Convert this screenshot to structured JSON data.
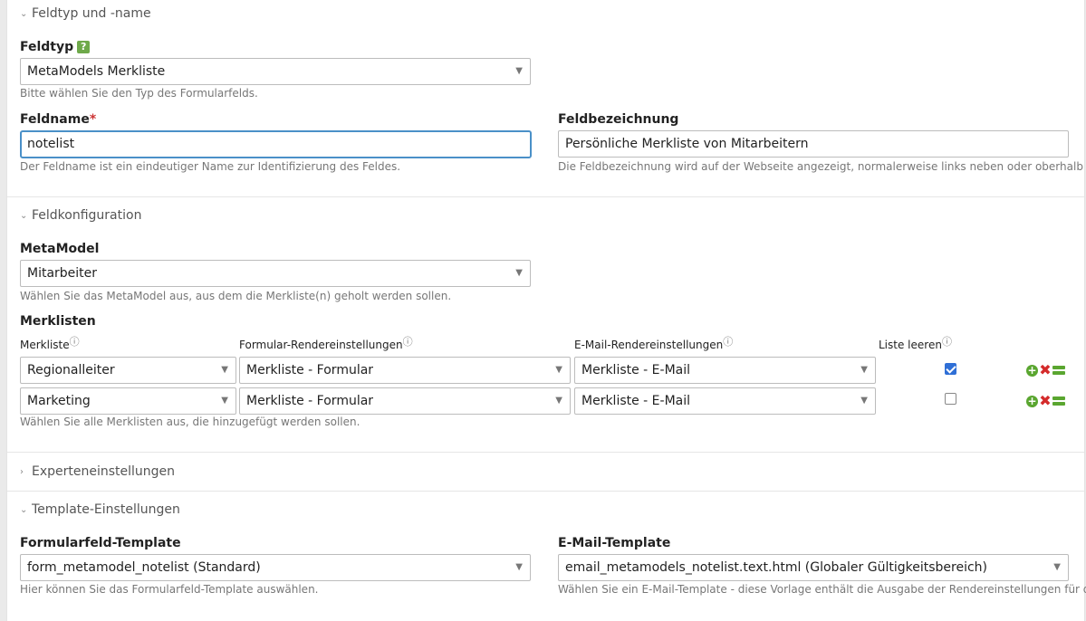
{
  "sections": {
    "type_name": {
      "title": "Feldtyp und -name"
    },
    "config": {
      "title": "Feldkonfiguration"
    },
    "expert": {
      "title": "Experteneinstellungen"
    },
    "template": {
      "title": "Template-Einstellungen"
    }
  },
  "feldtyp": {
    "label": "Feldtyp",
    "help": "?",
    "value": "MetaModels Merkliste",
    "hint": "Bitte wählen Sie den Typ des Formularfelds."
  },
  "feldname": {
    "label": "Feldname",
    "required_mark": "*",
    "value": "notelist",
    "hint": "Der Feldname ist ein eindeutiger Name zur Identifizierung des Feldes."
  },
  "feldbezeichnung": {
    "label": "Feldbezeichnung",
    "value": "Persönliche Merkliste von Mitarbeitern",
    "hint": "Die Feldbezeichnung wird auf der Webseite angezeigt, normalerweise links neben oder oberhalb"
  },
  "metamodel": {
    "label": "MetaModel",
    "value": "Mitarbeiter",
    "hint": "Wählen Sie das MetaModel aus, aus dem die Merkliste(n) geholt werden sollen."
  },
  "merklisten": {
    "label": "Merklisten",
    "columns": {
      "merkliste": "Merkliste",
      "formular": "Formular-Rendereinstellungen",
      "email": "E-Mail-Rendereinstellungen",
      "leeren": "Liste leeren",
      "info": "ⓘ"
    },
    "rows": [
      {
        "merkliste": "Regionalleiter",
        "formular": "Merkliste - Formular",
        "email": "Merkliste - E-Mail",
        "leeren": true
      },
      {
        "merkliste": "Marketing",
        "formular": "Merkliste - Formular",
        "email": "Merkliste - E-Mail",
        "leeren": false
      }
    ],
    "hint": "Wählen Sie alle Merklisten aus, die hinzugefügt werden sollen."
  },
  "formularfeld_template": {
    "label": "Formularfeld-Template",
    "value": "form_metamodel_notelist (Standard)",
    "hint": "Hier können Sie das Formularfeld-Template auswählen."
  },
  "email_template": {
    "label": "E-Mail-Template",
    "value": "email_metamodels_notelist.text.html (Globaler Gültigkeitsbereich)",
    "hint": "Wählen Sie ein E-Mail-Template - diese Vorlage enthält die Ausgabe der Rendereinstellungen für die"
  },
  "icons": {
    "expanded": "chevron-down-icon",
    "collapsed": "chevron-right-icon",
    "dropdown": "dropdown-arrow-icon",
    "info": "info-icon",
    "add": "add-row-icon",
    "delete": "delete-row-icon",
    "move": "drag-row-icon"
  },
  "colors": {
    "focus_border": "#4a90c8",
    "checkbox": "#2f6fd6",
    "add": "#5aa630",
    "delete": "#d42a2a",
    "required": "#cc3333",
    "help_badge": "#6ea94a"
  }
}
